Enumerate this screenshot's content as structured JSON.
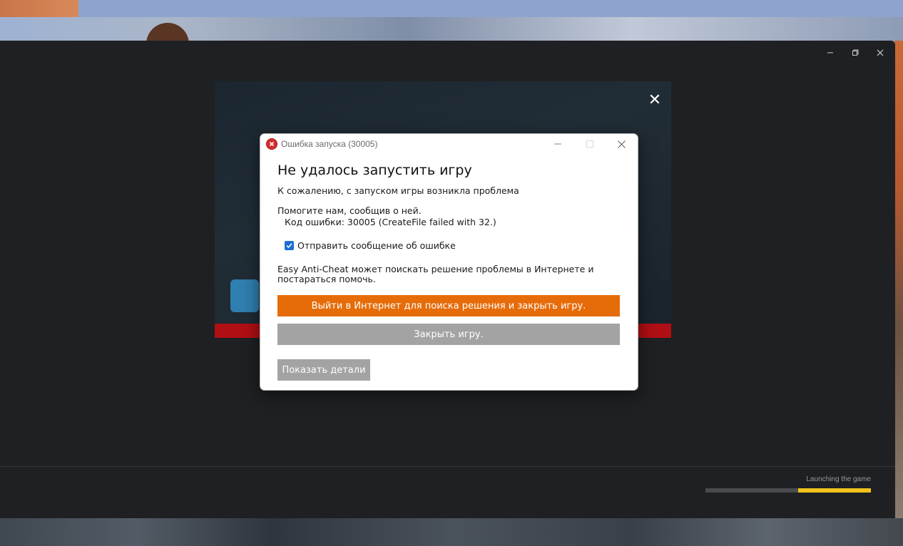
{
  "launcher": {
    "status_text": "Launching the game",
    "progress_fraction": 0.44,
    "colors": {
      "progress": "#f0c21a",
      "track": "#4a4b4f",
      "background": "#1f2023"
    }
  },
  "game_modal": {
    "close_symbol": "✕"
  },
  "dialog": {
    "title": "Ошибка запуска (30005)",
    "heading": "Не удалось запустить игру",
    "subtitle": "К сожалению, с запуском игры возникла проблема",
    "help_text": "Помогите нам, сообщив о ней.",
    "error_code": "Код ошибки: 30005 (CreateFile failed with 32.)",
    "checkbox_label": "Отправить сообщение об ошибке",
    "checkbox_checked": true,
    "eac_text": "Easy Anti-Cheat может поискать решение проблемы в Интернете и постараться помочь.",
    "primary_button": "Выйти в Интернет для поиска решения и закрыть игру.",
    "close_game_button": "Закрыть игру.",
    "details_button": "Показать детали",
    "colors": {
      "primary": "#e66c0a",
      "secondary": "#a3a3a3",
      "error_icon": "#d62d2d"
    }
  }
}
